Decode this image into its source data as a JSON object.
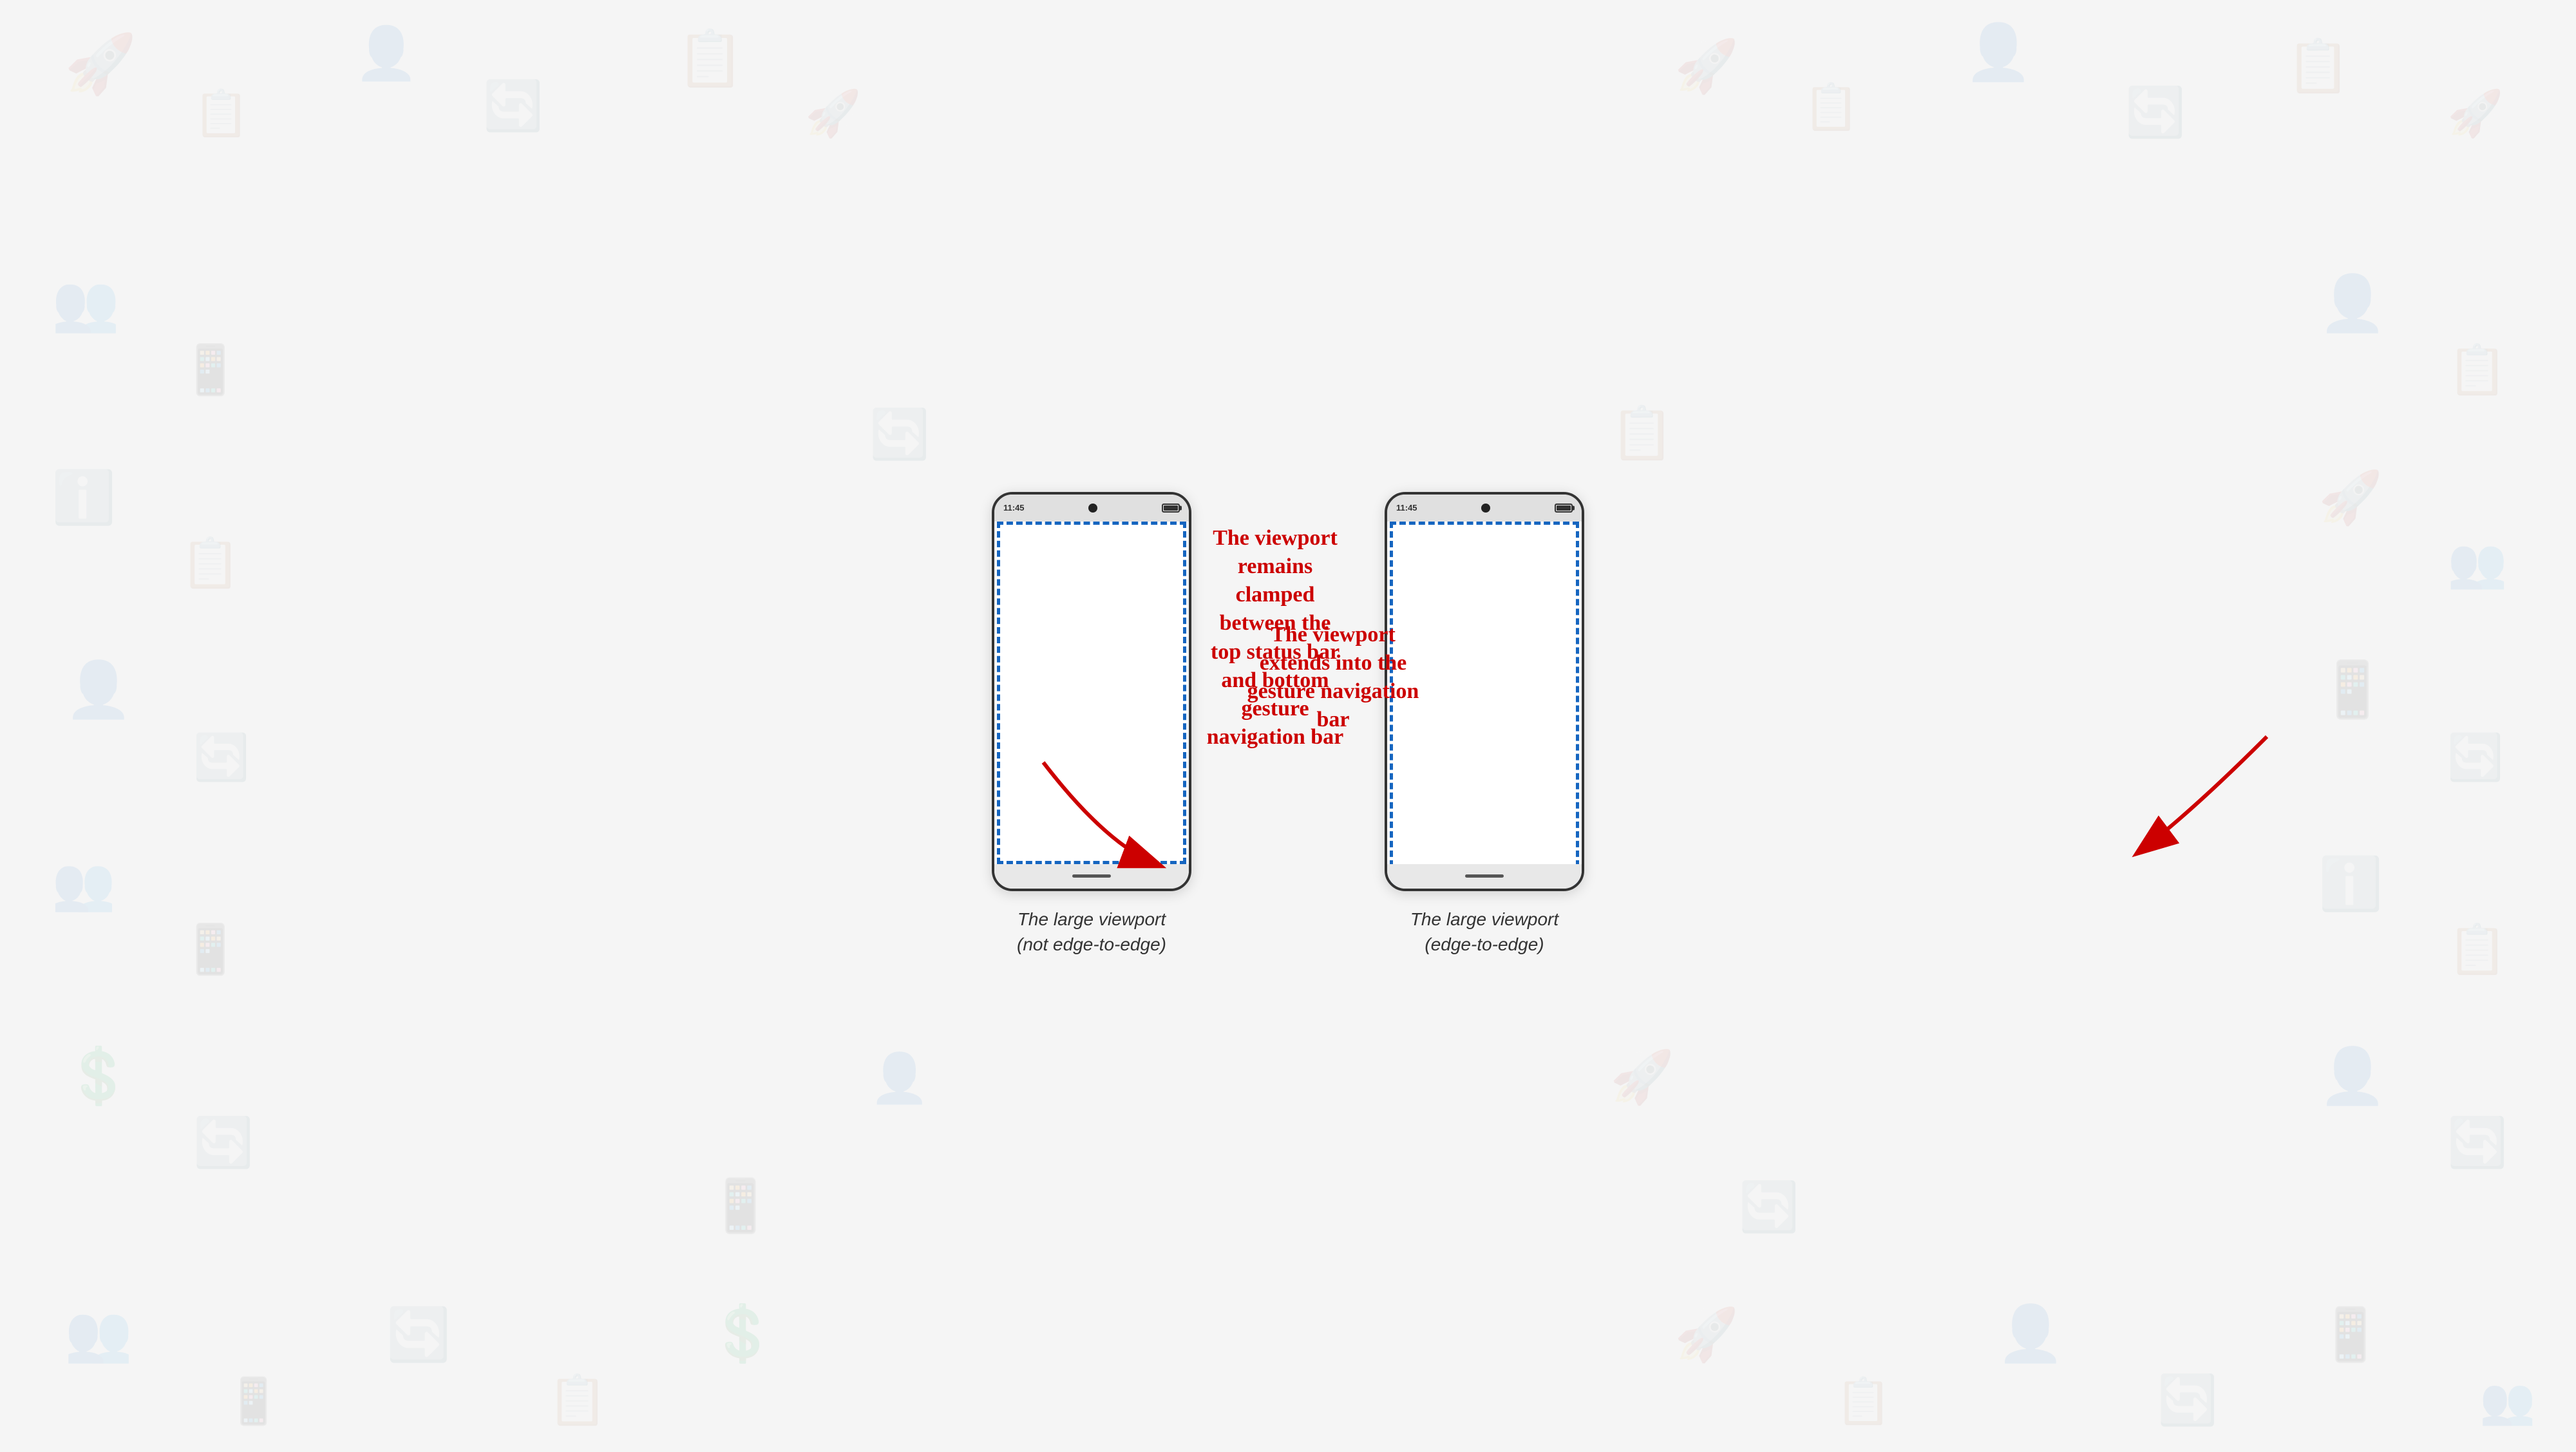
{
  "background": {
    "opacity": 0.07
  },
  "phone_left": {
    "status_time": "11:45",
    "caption_line1": "The large viewport",
    "caption_line2": "(not edge-to-edge)"
  },
  "phone_right": {
    "status_time": "11:45",
    "caption_line1": "The large viewport",
    "caption_line2": "(edge-to-edge)"
  },
  "annotation_left": {
    "line1": "The viewport",
    "line2": "remains",
    "line3": "clamped",
    "line4": "between the",
    "line5": "top status bar",
    "line6": "and bottom",
    "line7": "gesture",
    "line8": "navigation bar"
  },
  "annotation_right": {
    "line1": "The viewport",
    "line2": "extends into the",
    "line3": "gesture navigation",
    "line4": "bar"
  }
}
